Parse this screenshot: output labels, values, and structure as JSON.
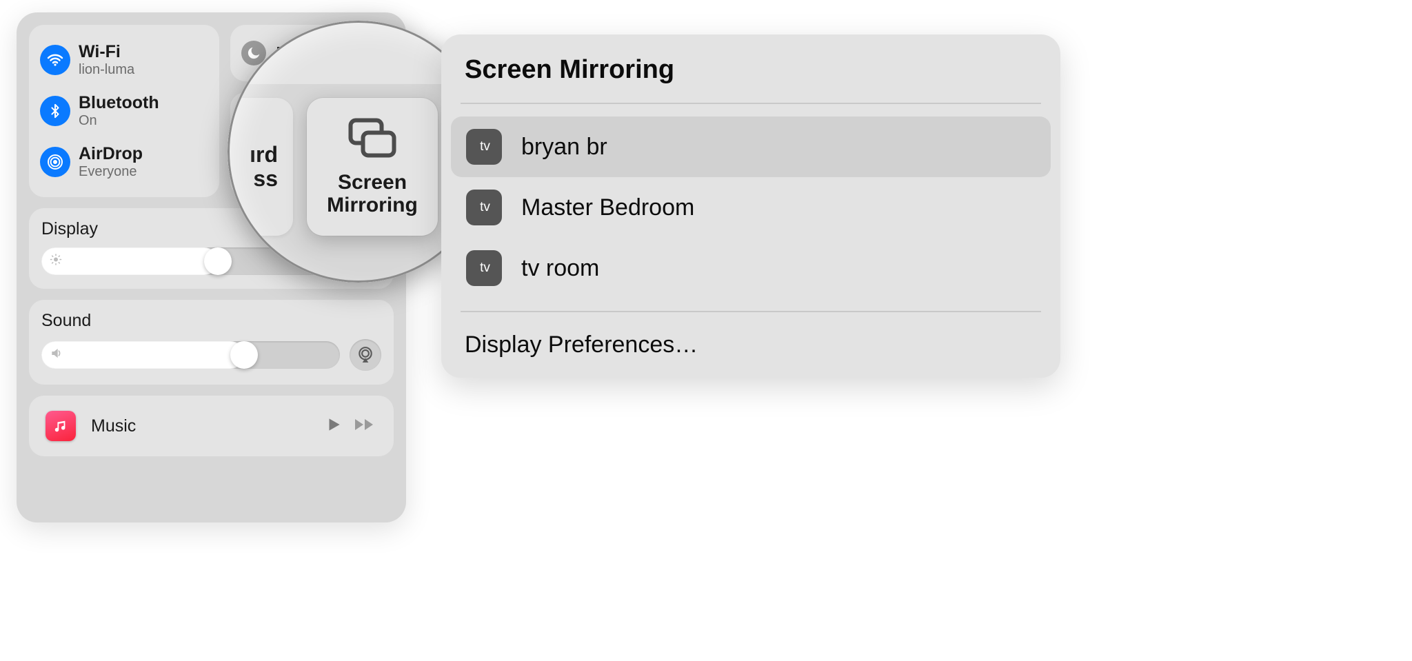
{
  "control_center": {
    "wifi": {
      "label": "Wi-Fi",
      "network": "lion-luma"
    },
    "bluetooth": {
      "label": "Bluetooth",
      "status": "On"
    },
    "airdrop": {
      "label": "AirDrop",
      "status": "Everyone"
    },
    "dnd": {
      "label": "D"
    },
    "keyboard_brightness": {
      "line1": "ird",
      "line2": "ss"
    },
    "screen_mirroring_tile": {
      "line1": "Screen",
      "line2": "Mirroring"
    },
    "display": {
      "title": "Display",
      "value_pct": 48
    },
    "sound": {
      "title": "Sound",
      "value_pct": 64
    },
    "music": {
      "label": "Music"
    }
  },
  "lens": {
    "keyboard_brightness": {
      "line1": "ırd",
      "line2": "ss"
    },
    "screen_mirroring": {
      "line1": "Screen",
      "line2": "Mirroring"
    },
    "display_title": "Display"
  },
  "mirror_panel": {
    "title": "Screen Mirroring",
    "devices": [
      {
        "badge": "tv",
        "name": "bryan br",
        "selected": true
      },
      {
        "badge": "tv",
        "name": "Master Bedroom",
        "selected": false
      },
      {
        "badge": "tv",
        "name": "tv room",
        "selected": false
      }
    ],
    "footer": "Display Preferences…"
  },
  "colors": {
    "accent": "#0a7aff"
  }
}
